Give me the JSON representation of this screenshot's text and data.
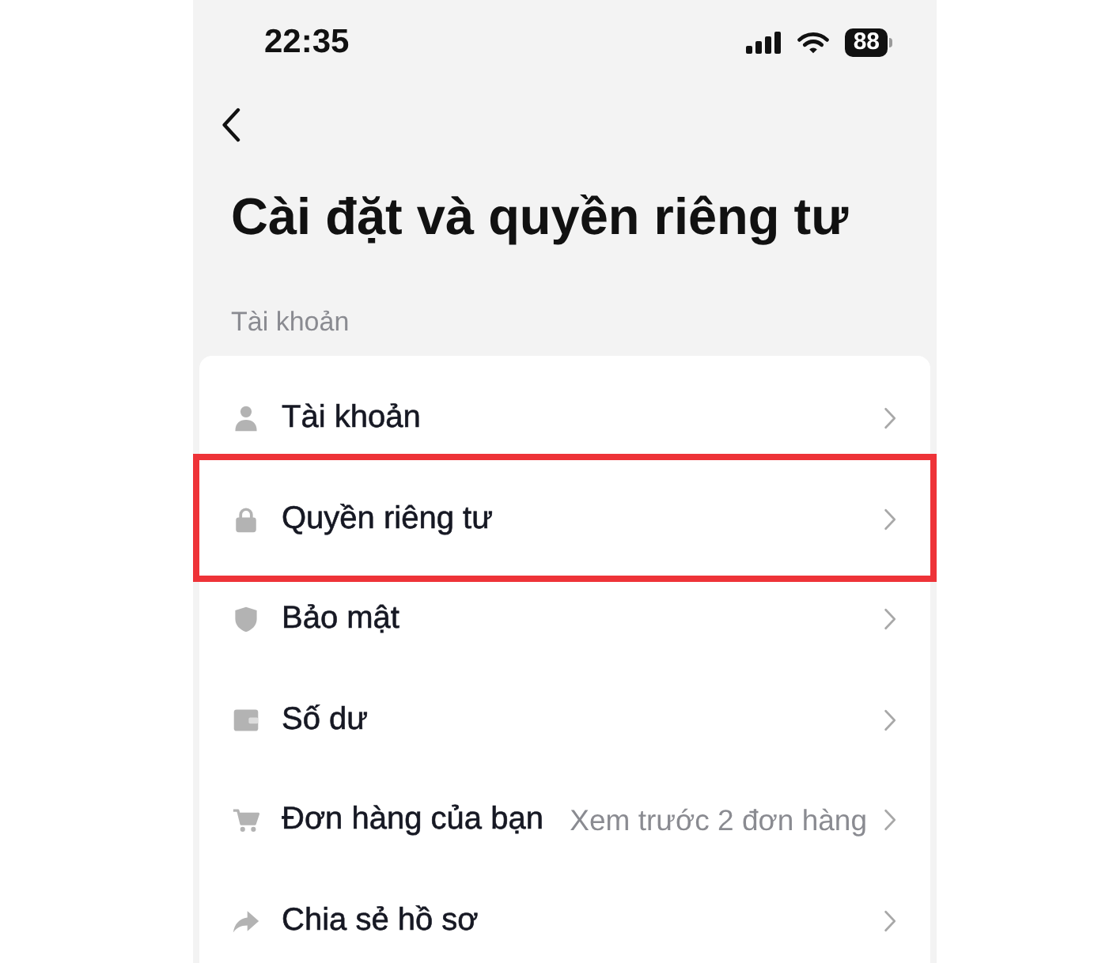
{
  "status_bar": {
    "time": "22:35",
    "battery": "88"
  },
  "header": {
    "title": "Cài đặt và quyền riêng tư"
  },
  "section": {
    "label": "Tài khoản",
    "items": [
      {
        "kind": "person",
        "label": "Tài khoản",
        "highlighted": false
      },
      {
        "kind": "lock",
        "label": "Quyền riêng tư",
        "highlighted": true
      },
      {
        "kind": "shield",
        "label": "Bảo mật",
        "highlighted": false
      },
      {
        "kind": "wallet",
        "label": "Số dư",
        "highlighted": false
      },
      {
        "kind": "cart",
        "label": "Đơn hàng của bạn",
        "detail": "Xem trước 2 đơn hàng",
        "highlighted": false
      },
      {
        "kind": "share",
        "label": "Chia sẻ hồ sơ",
        "highlighted": false
      }
    ]
  }
}
